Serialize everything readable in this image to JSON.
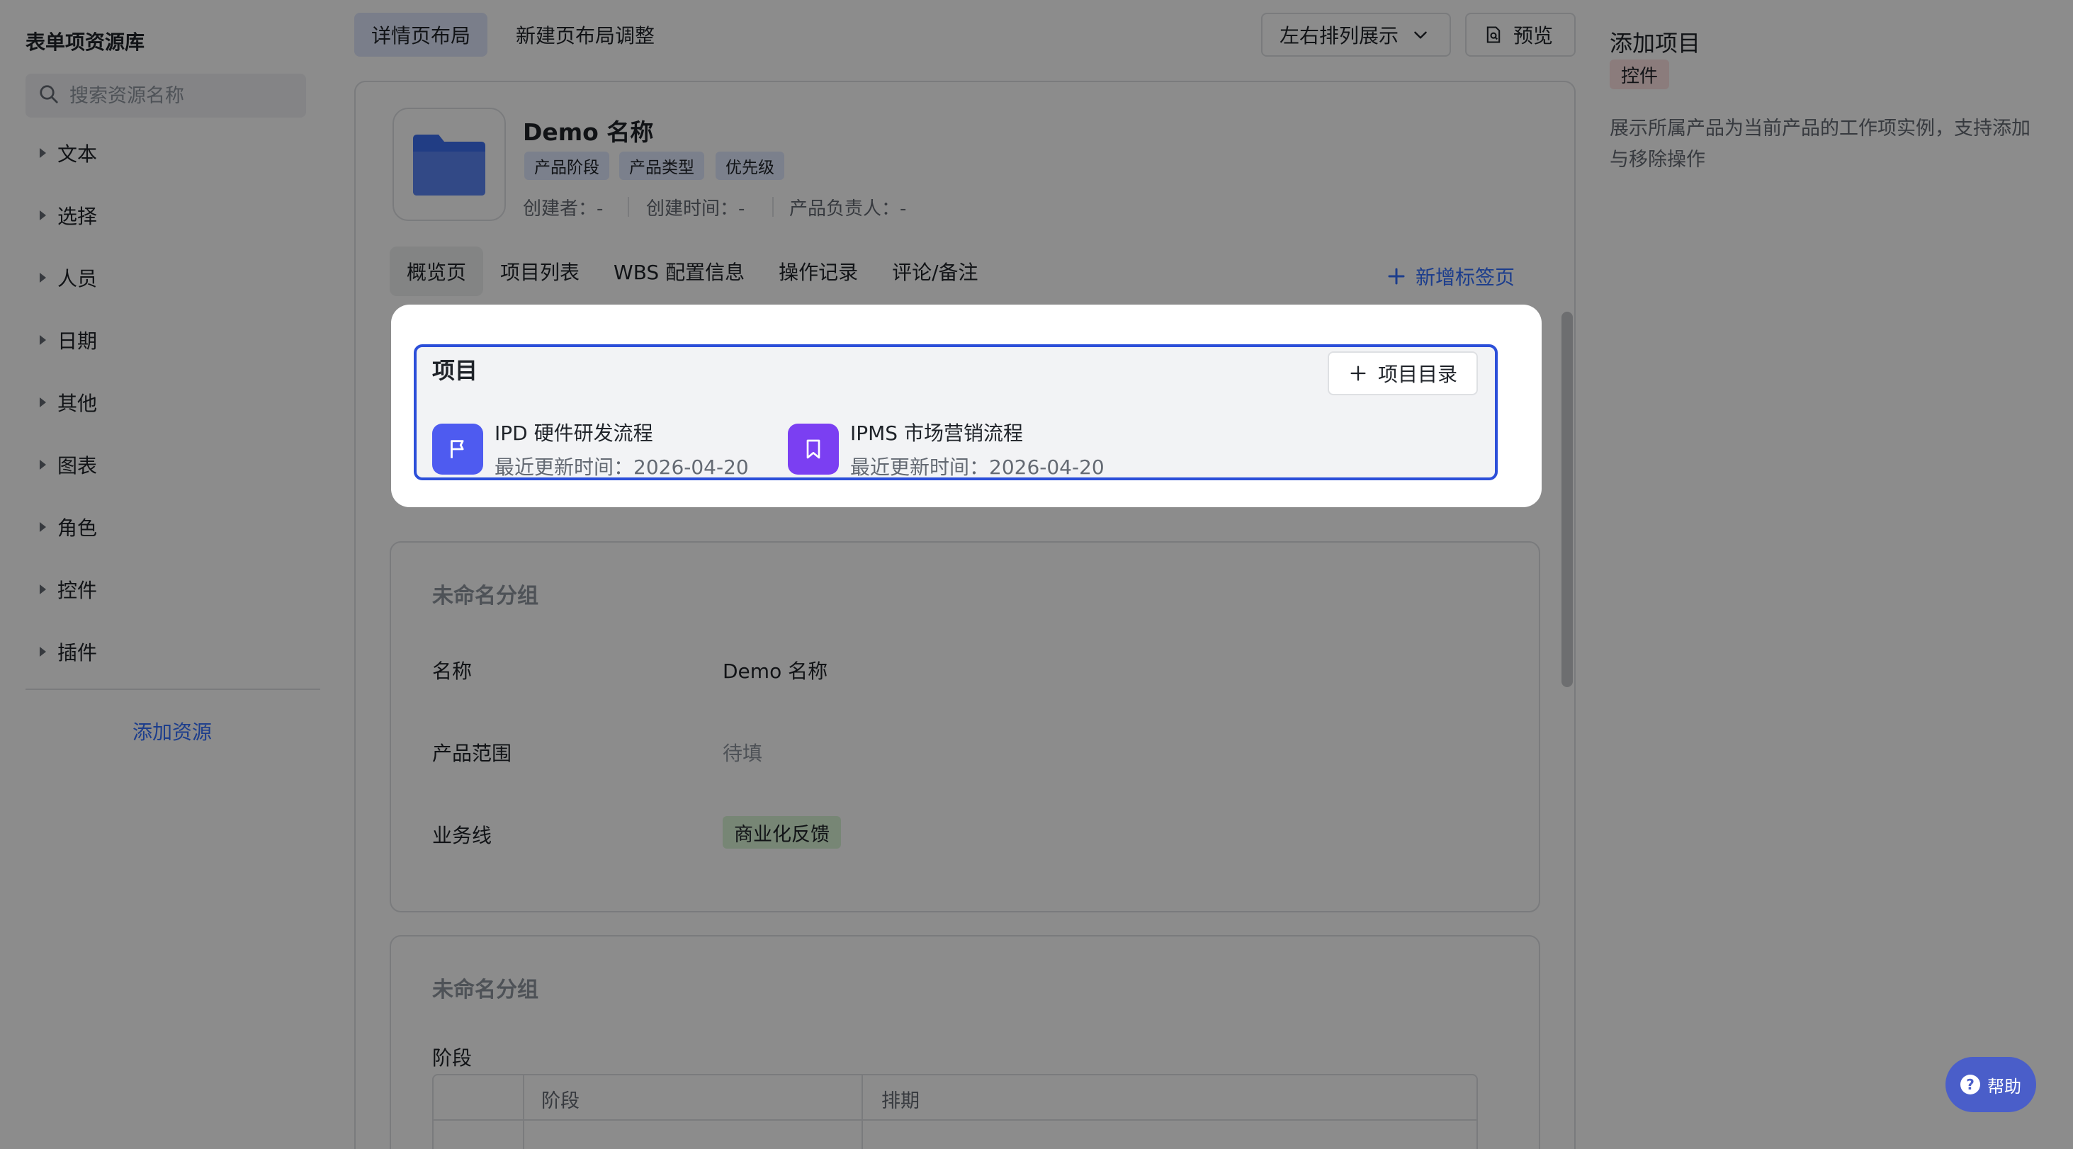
{
  "sidebar": {
    "title": "表单项资源库",
    "search_placeholder": "搜索资源名称",
    "categories": [
      "文本",
      "选择",
      "人员",
      "日期",
      "其他",
      "图表",
      "角色",
      "控件",
      "插件"
    ],
    "add_resource": "添加资源"
  },
  "topbar": {
    "tabs": [
      "详情页布局",
      "新建页布局调整"
    ],
    "layout_select": "左右排列展示",
    "preview": "预览"
  },
  "record": {
    "name": "Demo 名称",
    "tags": [
      "产品阶段",
      "产品类型",
      "优先级"
    ],
    "meta": [
      "创建者：-",
      "创建时间：-",
      "产品负责人：-"
    ]
  },
  "content_tabs": {
    "items": [
      "概览页",
      "项目列表",
      "WBS 配置信息",
      "操作记录",
      "评论/备注"
    ],
    "add_tab": "新增标签页"
  },
  "project_widget": {
    "title": "项目",
    "directory_button": "项目目录",
    "items": [
      {
        "name": "IPD 硬件研发流程",
        "time": "最近更新时间：2026-04-20",
        "color": "#4e5bf0"
      },
      {
        "name": "IPMS 市场营销流程",
        "time": "最近更新时间：2026-04-20",
        "color": "#7b3ff2"
      }
    ]
  },
  "group1": {
    "title": "未命名分组",
    "fields": [
      {
        "label": "名称",
        "value": "Demo 名称"
      },
      {
        "label": "产品范围",
        "value": "待填"
      },
      {
        "label": "业务线",
        "value": "商业化反馈"
      }
    ]
  },
  "group2": {
    "title": "未命名分组",
    "stage_label": "阶段",
    "table_headers": [
      "阶段",
      "排期"
    ]
  },
  "right_panel": {
    "title": "添加项目",
    "badge": "控件",
    "description": "展示所属产品为当前产品的工作项实例，支持添加与移除操作"
  },
  "help": "帮助"
}
